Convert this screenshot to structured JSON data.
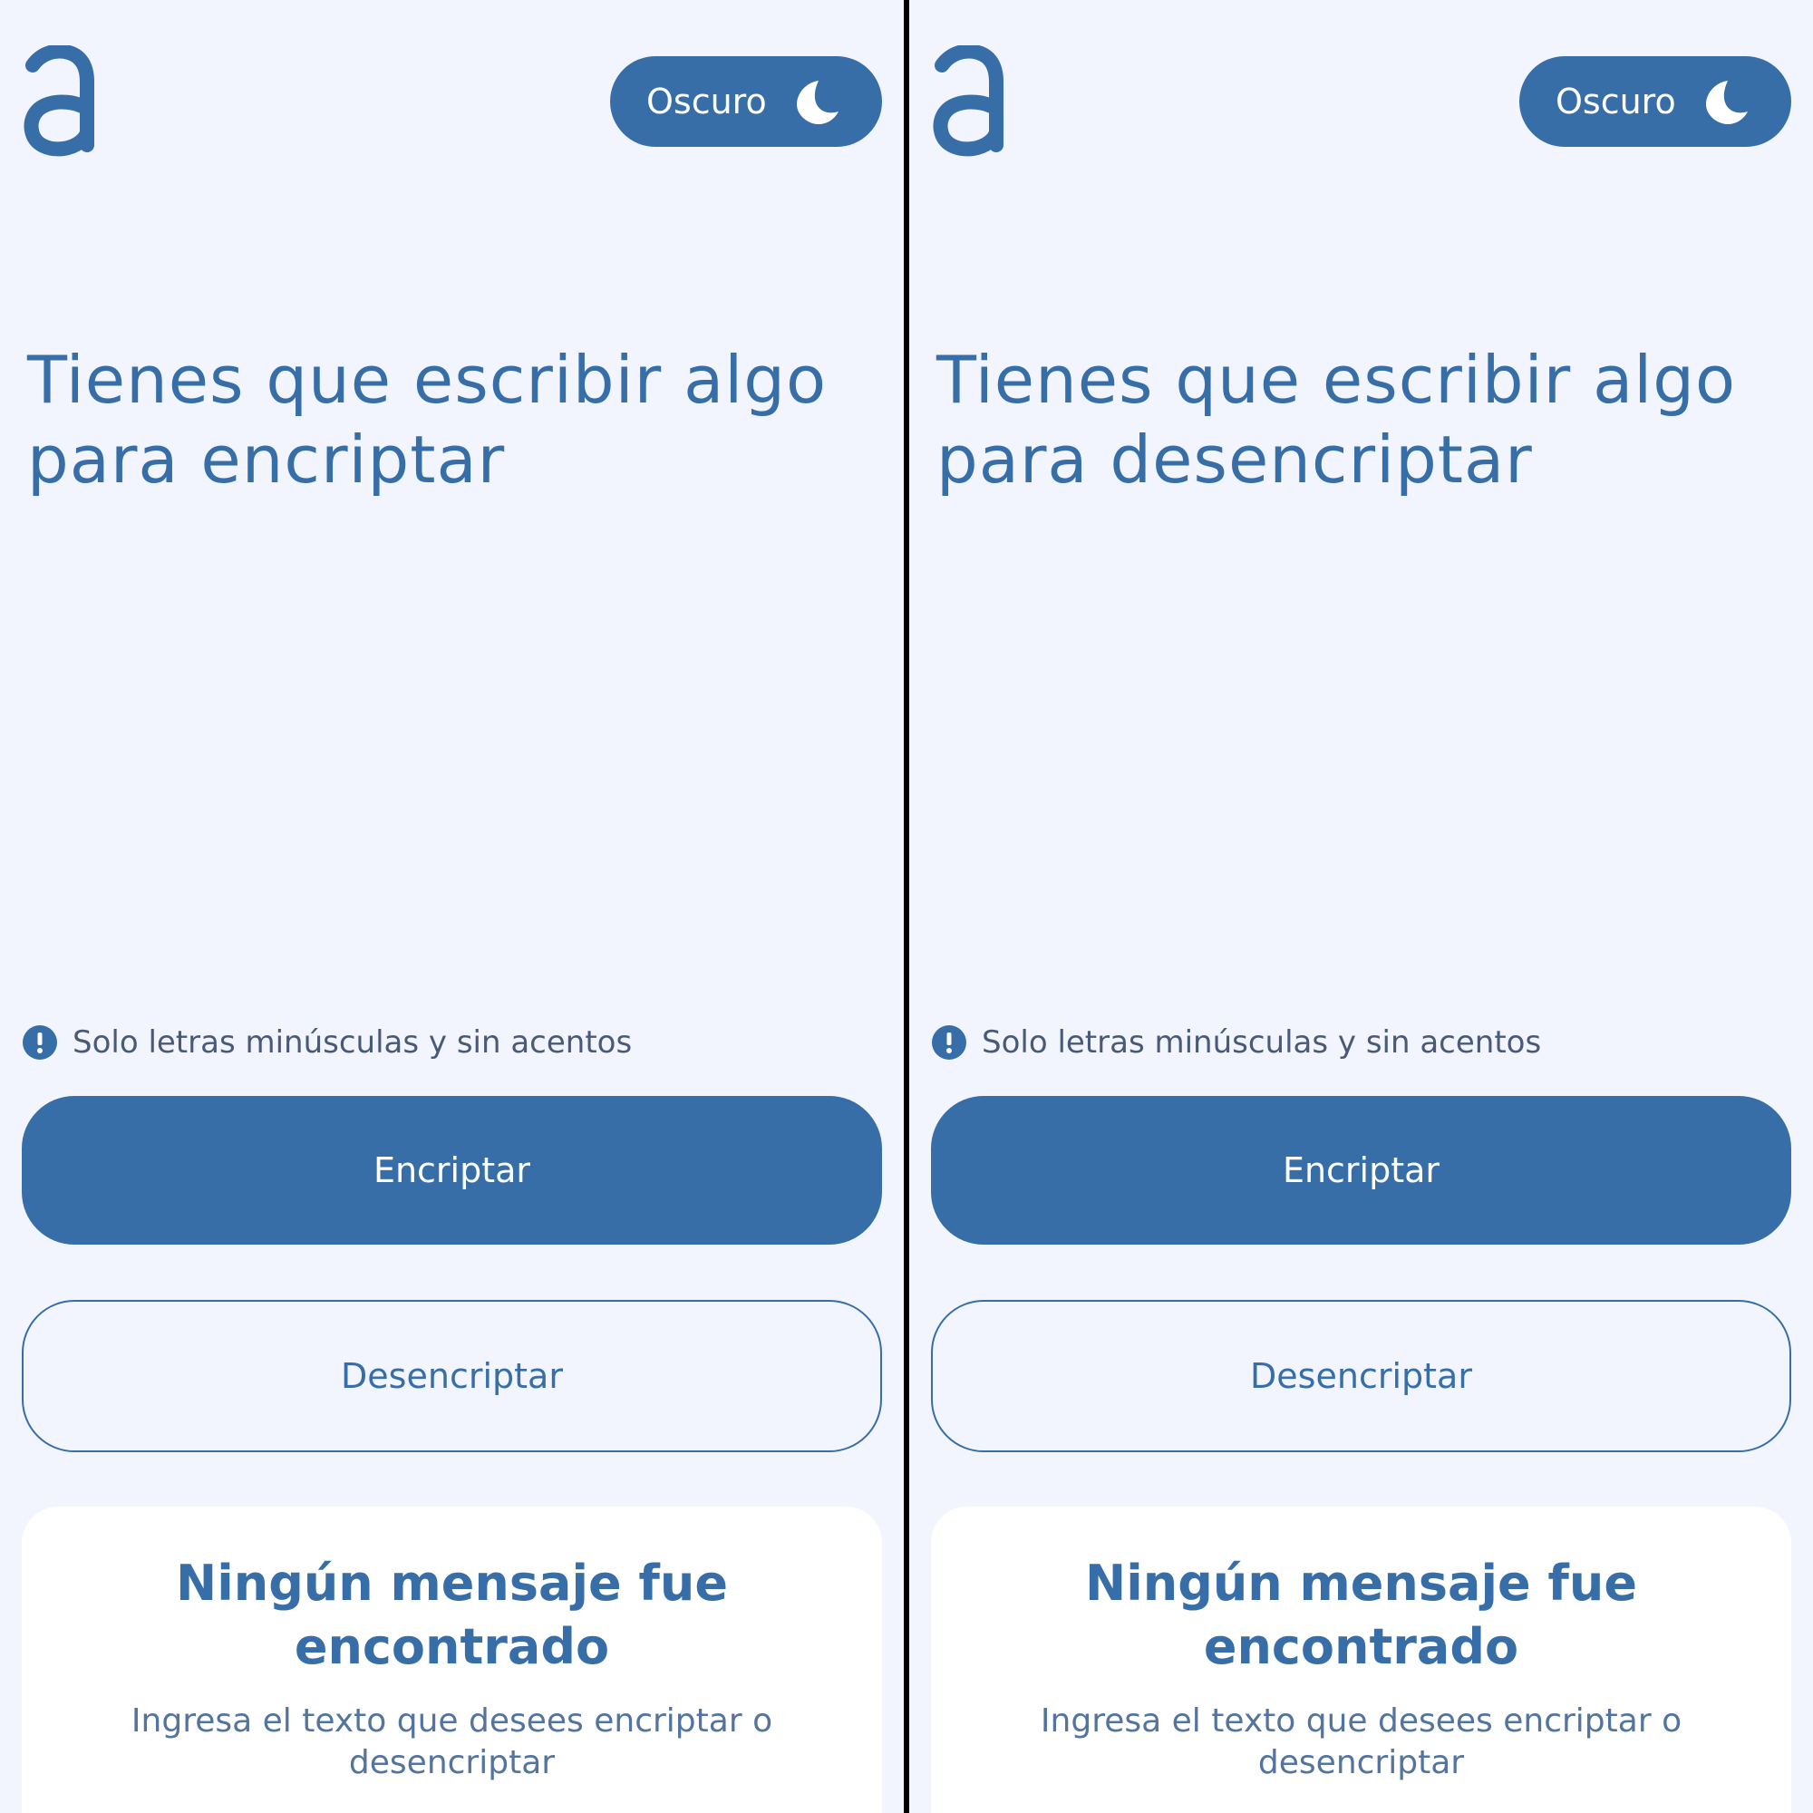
{
  "colors": {
    "accent": "#376ea8",
    "background": "#f2f5fd",
    "card": "#ffffff"
  },
  "panes": [
    {
      "logo_icon": "alura-a-logo-icon",
      "theme_toggle": {
        "label": "Oscuro",
        "icon": "moon-icon"
      },
      "prompt": {
        "line1": "Tienes que escribir algo",
        "line2": "para encriptar"
      },
      "hint": {
        "icon": "exclamation-circle-icon",
        "text": "Solo letras minúsculas y sin acentos"
      },
      "encrypt_button": "Encriptar",
      "decrypt_button": "Desencriptar",
      "result_card": {
        "title": "Ningún mensaje fue encontrado",
        "body": "Ingresa el texto que desees encriptar o desencriptar"
      }
    },
    {
      "logo_icon": "alura-a-logo-icon",
      "theme_toggle": {
        "label": "Oscuro",
        "icon": "moon-icon"
      },
      "prompt": {
        "line1": "Tienes que escribir algo",
        "line2": "para desencriptar"
      },
      "hint": {
        "icon": "exclamation-circle-icon",
        "text": "Solo letras minúsculas y sin acentos"
      },
      "encrypt_button": "Encriptar",
      "decrypt_button": "Desencriptar",
      "result_card": {
        "title": "Ningún mensaje fue encontrado",
        "body": "Ingresa el texto que desees encriptar o desencriptar"
      }
    }
  ]
}
